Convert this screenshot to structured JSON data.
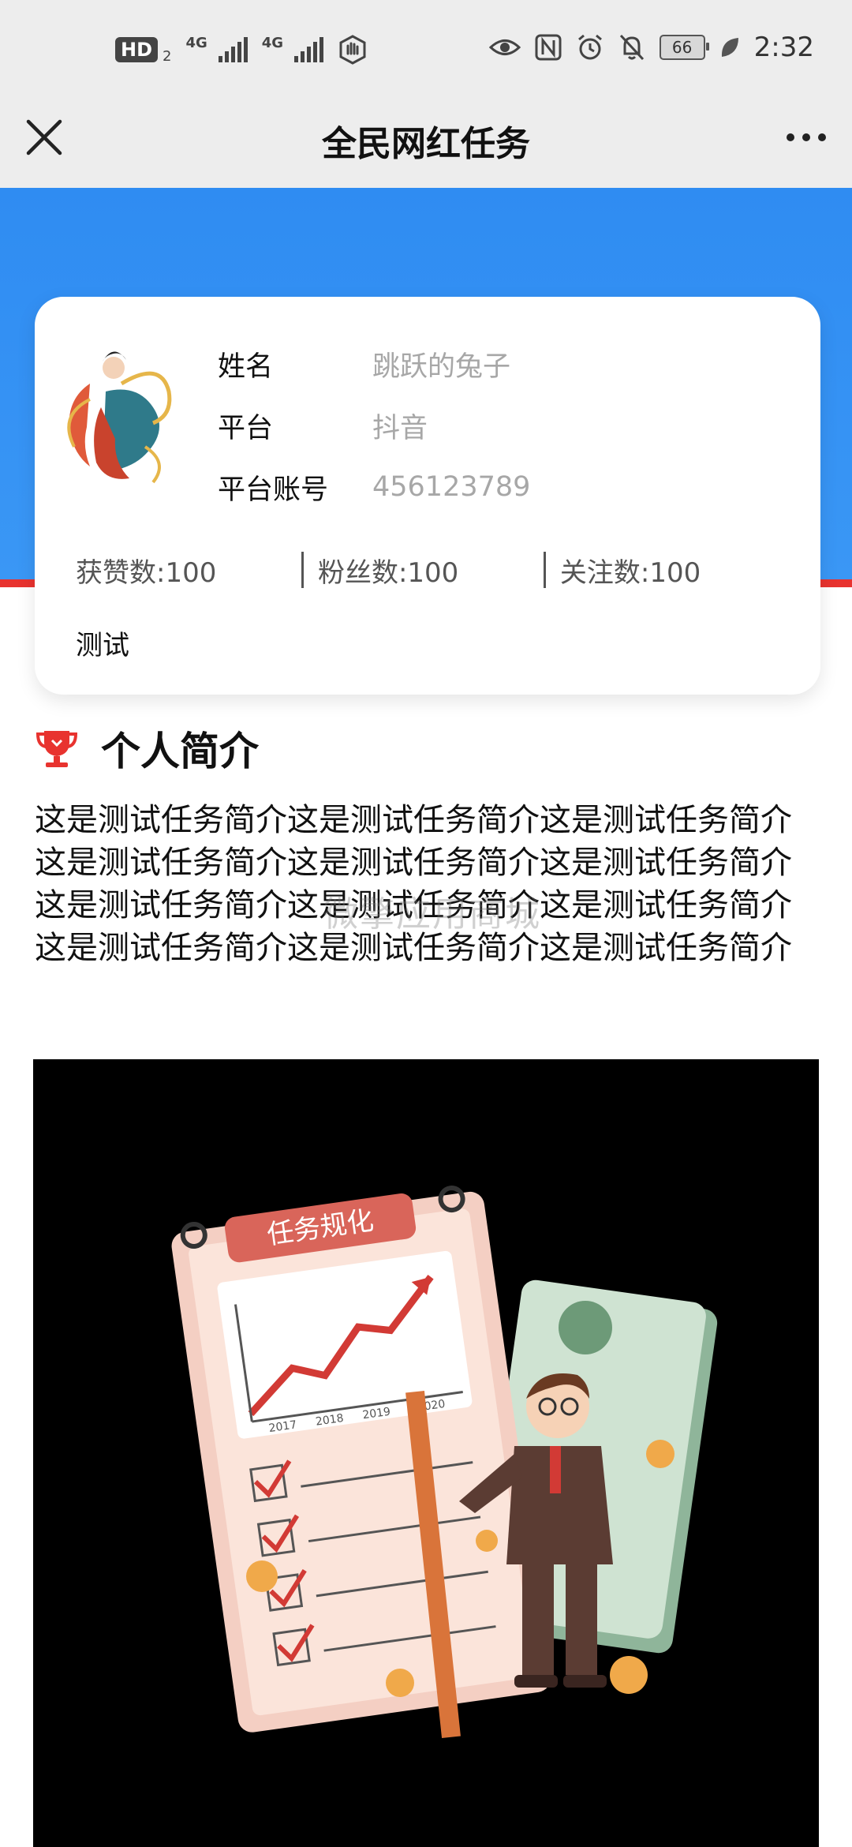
{
  "status_bar": {
    "hd": "HD",
    "sim_slot": "2",
    "network_1": "4G",
    "network_2": "4G",
    "battery": "66",
    "time": "2:32",
    "icons": [
      "hd-icon",
      "signal-icon",
      "signal-icon",
      "gesture-icon",
      "eye-icon",
      "nfc-icon",
      "alarm-icon",
      "mute-icon",
      "battery-icon",
      "leaf-icon"
    ]
  },
  "nav": {
    "title": "全民网红任务",
    "close_icon": "close-icon",
    "more_icon": "more-icon"
  },
  "profile": {
    "fields": [
      {
        "label": "姓名",
        "value": "跳跃的兔子"
      },
      {
        "label": "平台",
        "value": "抖音"
      },
      {
        "label": "平台账号",
        "value": "456123789"
      }
    ],
    "stats": [
      {
        "text": "获赞数:100"
      },
      {
        "text": "粉丝数:100"
      },
      {
        "text": "关注数:100"
      }
    ],
    "tagline": "测试"
  },
  "intro": {
    "title": "个人简介",
    "icon": "trophy-icon",
    "text": "这是测试任务简介这是测试任务简介这是测试任务简介这是测试任务简介这是测试任务简介这是测试任务简介这是测试任务简介这是测试任务简介这是测试任务简介这是测试任务简介这是测试任务简介这是测试任务简介"
  },
  "watermark": "微擎应用商城",
  "illustration": {
    "calendar_title": "任务规化",
    "chart_x_labels": [
      "2017",
      "2018",
      "2019",
      "2020"
    ]
  },
  "colors": {
    "blue_band": "#3a97f5",
    "red_accent": "#e8332f",
    "nav_bg": "#ededed"
  }
}
